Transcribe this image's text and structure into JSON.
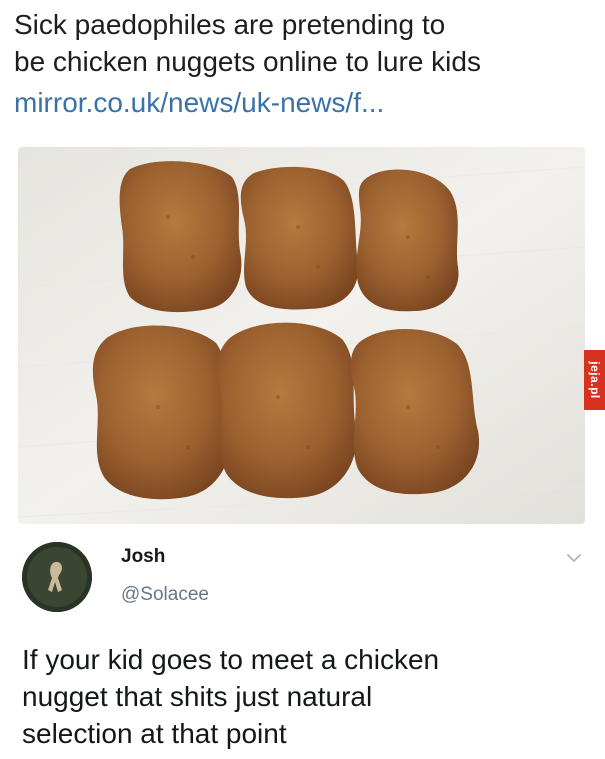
{
  "article": {
    "headline_lines": [
      "Sick paedophiles are pretending to",
      "be chicken nuggets online to lure kids"
    ],
    "link_text": "mirror.co.uk/news/uk-news/f...",
    "image_icon": "chicken-nuggets-photo"
  },
  "watermark": {
    "text": "jeja.pl",
    "color": "#d7311f"
  },
  "tweet": {
    "author_name": "Josh",
    "author_handle": "@Solacee",
    "avatar_icon": "avatar-photo",
    "menu_icon": "chevron-down-icon",
    "text_lines": [
      "If your kid goes to meet a chicken",
      "nugget that shits just natural",
      "selection at that point"
    ]
  },
  "colors": {
    "link": "#3a72a8",
    "handle": "#657786",
    "text": "#14171a"
  }
}
